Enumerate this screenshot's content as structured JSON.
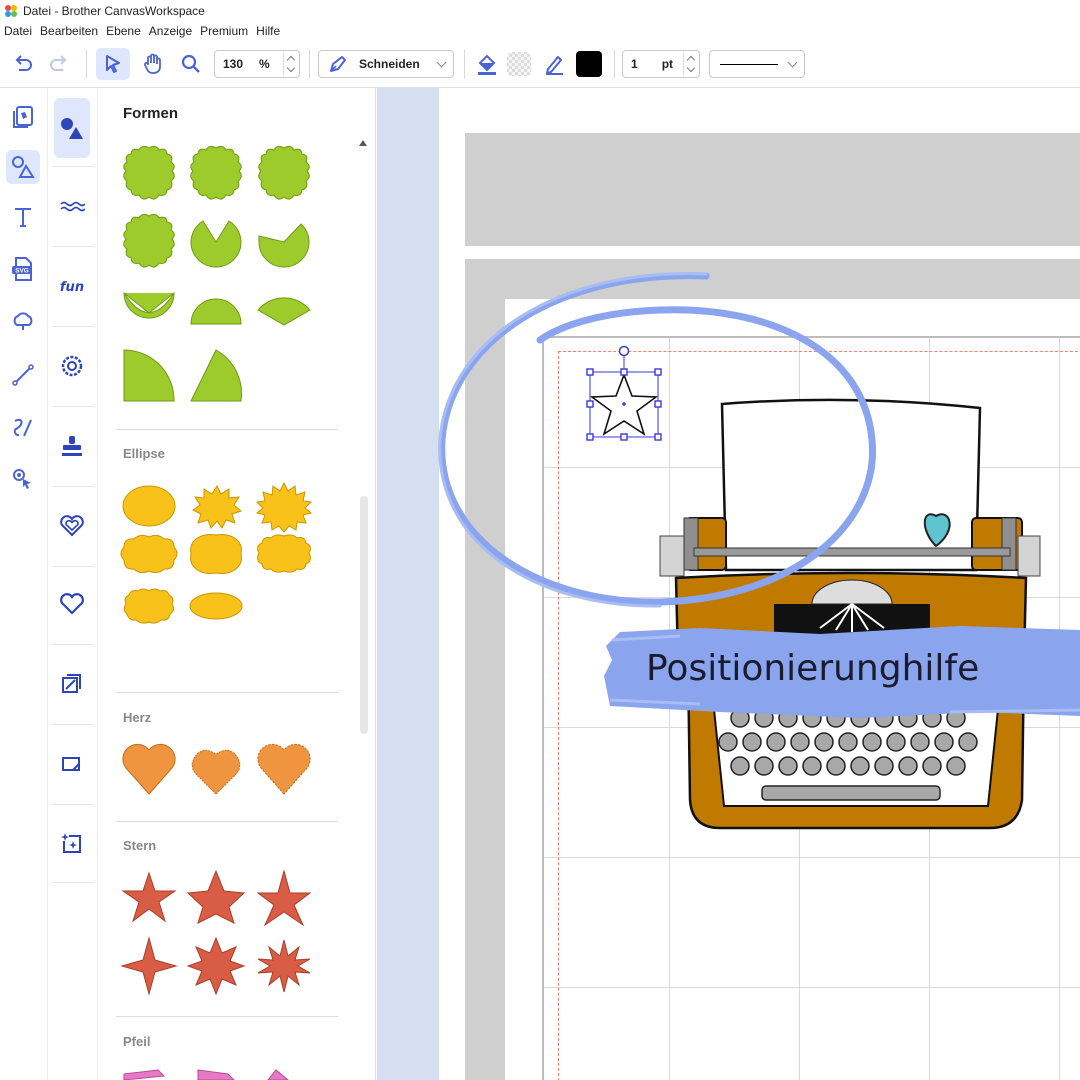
{
  "window": {
    "title": "Datei - Brother CanvasWorkspace"
  },
  "menu": [
    "Datei",
    "Bearbeiten",
    "Ebene",
    "Anzeige",
    "Premium",
    "Hilfe"
  ],
  "toolbar": {
    "zoom_value": "130",
    "zoom_unit": "%",
    "mode_label": "Schneiden",
    "line_width": "1",
    "line_unit": "pt",
    "fill_color": "#000000"
  },
  "panel": {
    "title": "Formen",
    "sections": [
      "Ellipse",
      "Herz",
      "Stern",
      "Pfeil"
    ]
  },
  "annotation": {
    "label": "Positionierunghilfe"
  },
  "colors": {
    "accent": "#4a64d6",
    "green": "#9ccb2b",
    "yellow": "#f8c21a",
    "orange": "#ef9540",
    "red": "#d95d44",
    "brush": "#8aa5ee",
    "typewriter": "#c07a00"
  }
}
